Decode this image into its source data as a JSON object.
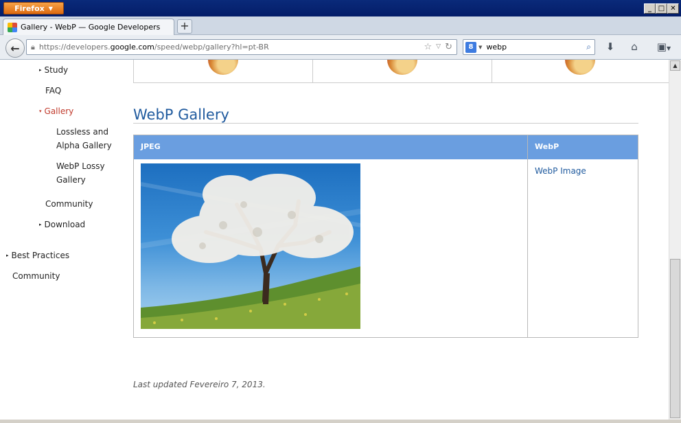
{
  "browser": {
    "menu_button": "Firefox",
    "tab_title": "Gallery - WebP — Google Developers",
    "new_tab": "+",
    "url_prefix": "https://developers.",
    "url_domain": "google.com",
    "url_suffix": "/speed/webp/gallery?hl=pt-BR",
    "search_value": "webp",
    "search_engine_glyph": "8"
  },
  "sidebar": {
    "items": [
      {
        "label": "Study",
        "expander": "▸"
      },
      {
        "label": "FAQ"
      },
      {
        "label": "Gallery",
        "expander": "▾"
      },
      {
        "label": "Lossless and"
      },
      {
        "label": "Alpha Gallery"
      },
      {
        "label": "WebP Lossy"
      },
      {
        "label": "Gallery"
      },
      {
        "label": "Community"
      },
      {
        "label": "Download",
        "expander": "▸"
      },
      {
        "label": "Best Practices",
        "expander": "▸"
      },
      {
        "label": "Community"
      }
    ]
  },
  "main": {
    "title": "WebP Gallery",
    "table": {
      "col_jpeg": "JPEG",
      "col_webp": "WebP",
      "webp_link": "WebP Image"
    },
    "last_updated": "Last updated Fevereiro 7, 2013."
  },
  "colors": {
    "accent_blue": "#1f5a9e",
    "header_blue": "#6a9ee0",
    "active_red": "#c0392b",
    "firefox_orange": "#e67e22"
  }
}
